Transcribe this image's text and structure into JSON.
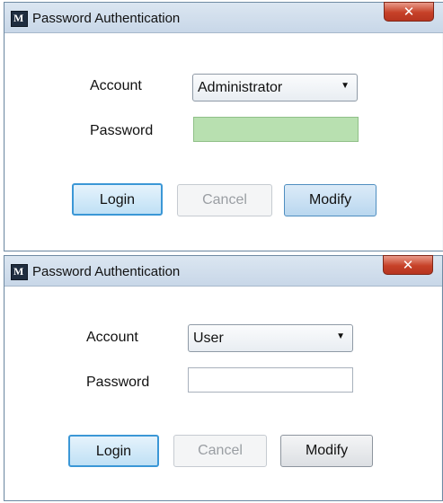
{
  "dialogs": [
    {
      "title": "Password Authentication",
      "close_icon": "close-icon",
      "account_label": "Account",
      "account_value": "Administrator",
      "password_label": "Password",
      "password_value": "",
      "login_label": "Login",
      "cancel_label": "Cancel",
      "modify_label": "Modify"
    },
    {
      "title": "Password Authentication",
      "close_icon": "close-icon",
      "account_label": "Account",
      "account_value": "User",
      "password_label": "Password",
      "password_value": "",
      "login_label": "Login",
      "cancel_label": "Cancel",
      "modify_label": "Modify"
    }
  ],
  "colors": {
    "title_bar": "#c8d7e8",
    "close_button": "#c64128",
    "password_highlight": "#b8e0b0",
    "default_button_border": "#3b97d6"
  }
}
